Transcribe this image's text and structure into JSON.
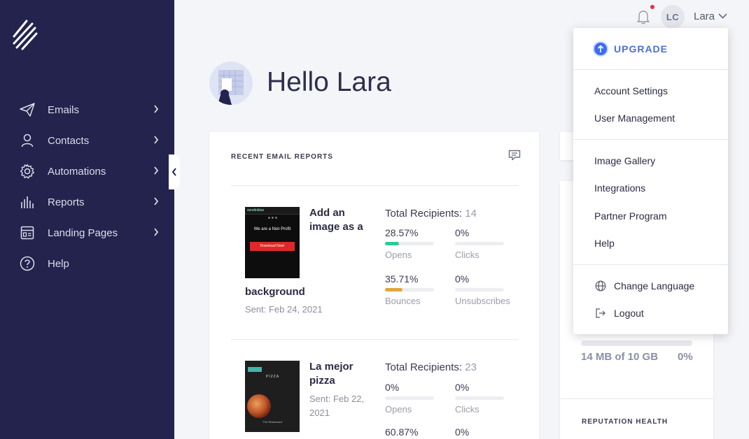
{
  "colors": {
    "sidebar": "#23234d",
    "accent": "#3b6df0",
    "opens_bar": "#2ec99b",
    "bounces_bar": "#e0a83a",
    "notification_dot": "#e0304a"
  },
  "sidebar": {
    "items": [
      {
        "label": "Emails",
        "icon": "paper-plane-icon",
        "has_chevron": true
      },
      {
        "label": "Contacts",
        "icon": "person-icon",
        "has_chevron": true
      },
      {
        "label": "Automations",
        "icon": "gear-icon",
        "has_chevron": true
      },
      {
        "label": "Reports",
        "icon": "bar-chart-icon",
        "has_chevron": true
      },
      {
        "label": "Landing Pages",
        "icon": "layout-icon",
        "has_chevron": true
      },
      {
        "label": "Help",
        "icon": "help-circle-icon",
        "has_chevron": false
      }
    ]
  },
  "topbar": {
    "avatar_initials": "LC",
    "username": "Lara"
  },
  "greeting": "Hello Lara",
  "reports_card": {
    "title": "RECENT EMAIL REPORTS",
    "reports": [
      {
        "title_line1": "Add an",
        "title_line2": "image as a",
        "title_line3": "background",
        "sent": "Sent: Feb 24, 2021",
        "thumb": {
          "header": "sendinblue",
          "text": "We are a Non Profit",
          "button": "Download Now!"
        },
        "recipients_label": "Total Recipients:",
        "recipients": "14",
        "metrics": [
          {
            "value": "28.57%",
            "label": "Opens",
            "fill": 0.2857
          },
          {
            "value": "0%",
            "label": "Clicks",
            "fill": 0
          },
          {
            "value": "35.71%",
            "label": "Bounces",
            "fill": 0.3571
          },
          {
            "value": "0%",
            "label": "Unsubscribes",
            "fill": 0
          }
        ]
      },
      {
        "title_line1": "La mejor",
        "title_line2": "pizza",
        "sent_line1": "Sent: Feb 22,",
        "sent_line2": "2021",
        "thumb": {
          "header": "PIZZA",
          "footer": "The Restaurant"
        },
        "recipients_label": "Total Recipients:",
        "recipients": "23",
        "metrics": [
          {
            "value": "0%",
            "label": "Opens",
            "fill": 0
          },
          {
            "value": "0%",
            "label": "Clicks",
            "fill": 0
          },
          {
            "value": "60.87%",
            "fill": 0.6087
          },
          {
            "value": "0%",
            "fill": 0
          }
        ]
      }
    ]
  },
  "right_panel": {
    "storage_text": "14 MB of 10 GB",
    "storage_pct": "0%",
    "storage_fill": 0,
    "reputation_title": "REPUTATION HEALTH"
  },
  "user_menu": {
    "upgrade": "UPGRADE",
    "section1": [
      "Account Settings",
      "User Management"
    ],
    "section2": [
      "Image Gallery",
      "Integrations",
      "Partner Program",
      "Help"
    ],
    "section3": [
      {
        "label": "Change Language",
        "icon": "globe-icon"
      },
      {
        "label": "Logout",
        "icon": "logout-icon"
      }
    ]
  }
}
